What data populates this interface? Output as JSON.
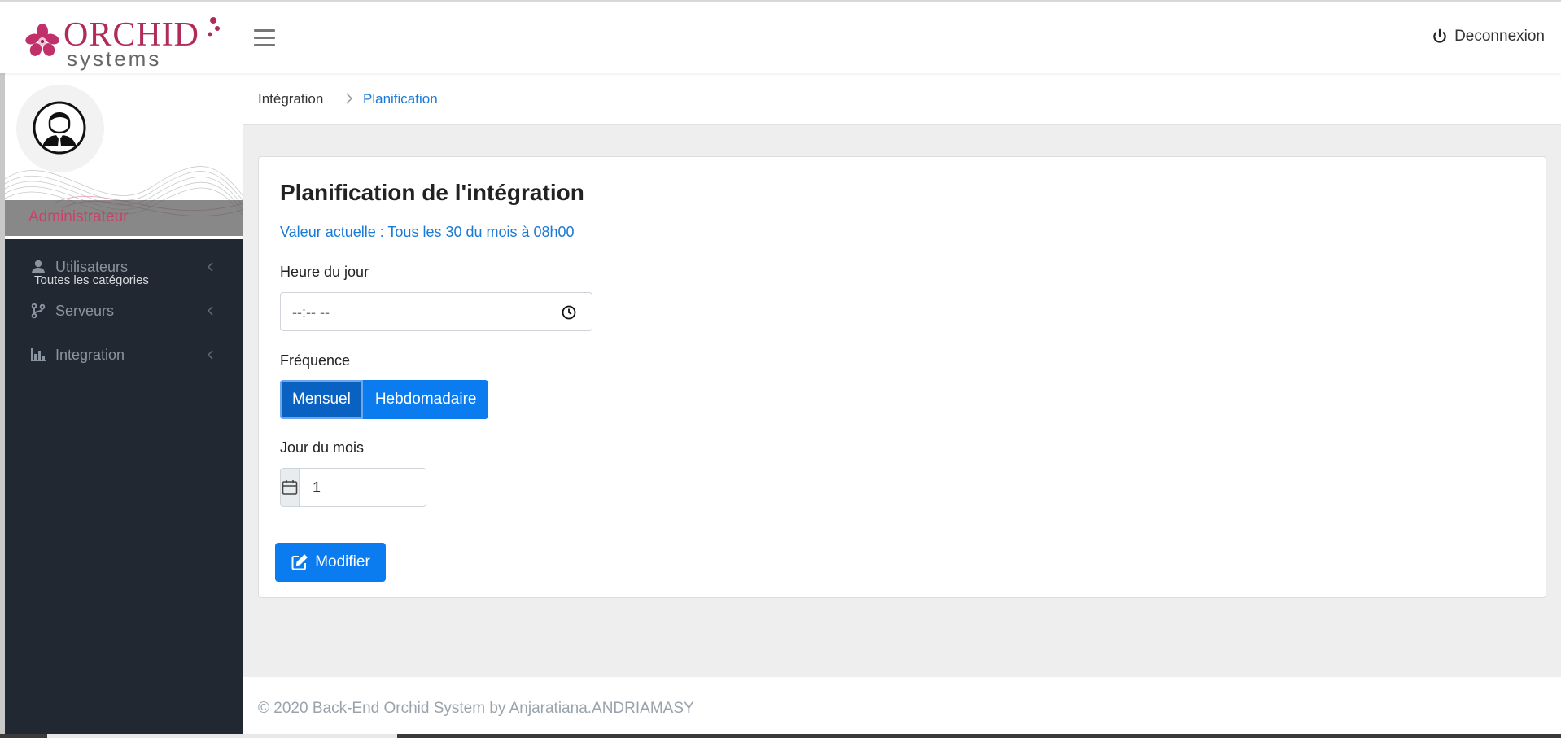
{
  "header": {
    "logo_name": "ORCHID",
    "logo_sub": "systems",
    "logout_label": "Deconnexion"
  },
  "sidebar": {
    "role": "Administrateur",
    "category_title": "Toutes les catégories",
    "items": [
      {
        "label": "Utilisateurs",
        "icon": "user-icon"
      },
      {
        "label": "Serveurs",
        "icon": "branch-icon"
      },
      {
        "label": "Integration",
        "icon": "bar-chart-icon"
      }
    ]
  },
  "breadcrumb": {
    "parent": "Intégration",
    "current": "Planification"
  },
  "card": {
    "title": "Planification de l'intégration",
    "current_value": "Valeur actuelle : Tous les 30 du mois à 08h00",
    "hour_label": "Heure du jour",
    "hour_placeholder": "--:-- --",
    "frequency_label": "Fréquence",
    "frequency_options": [
      "Mensuel",
      "Hebdomadaire"
    ],
    "frequency_selected": "Mensuel",
    "day_label": "Jour du mois",
    "day_value": "1",
    "submit_label": "Modifier"
  },
  "footer": {
    "text": "© 2020 Back-End Orchid System by Anjaratiana.ANDRIAMASY"
  },
  "colors": {
    "brand": "#b12a5a",
    "primary": "#0a7cf0",
    "sidebar_bg": "#222831"
  }
}
